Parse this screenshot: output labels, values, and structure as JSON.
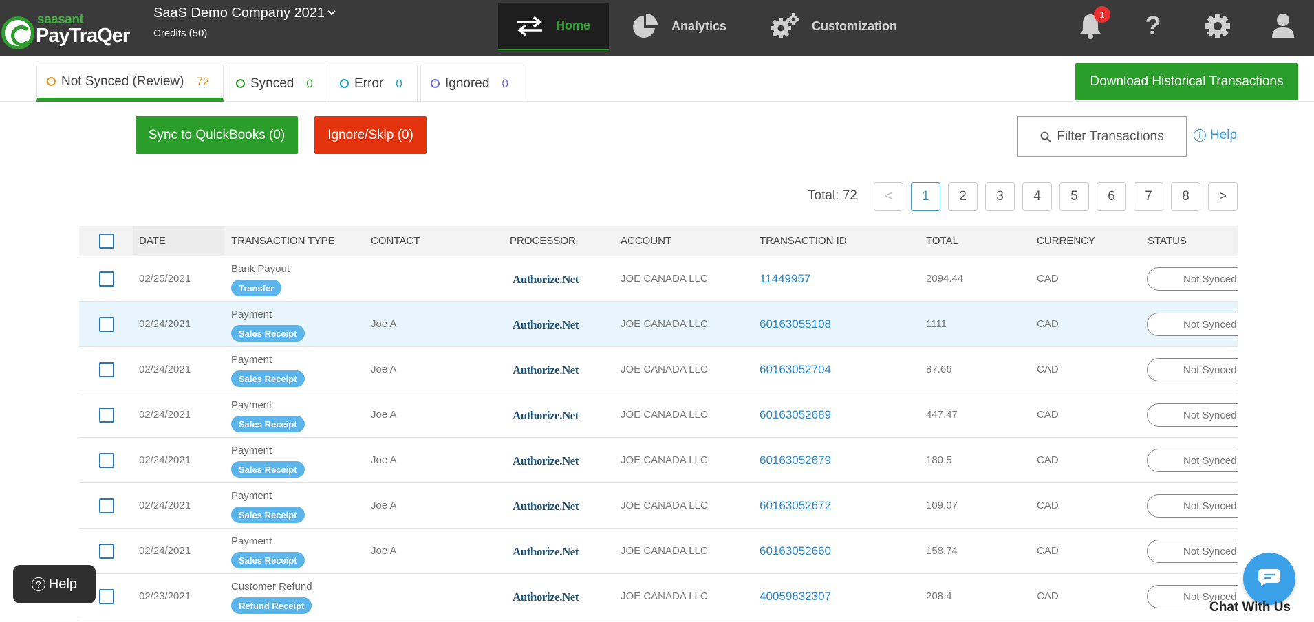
{
  "app": {
    "logo_small": "saasant",
    "logo_main": "PayTraQer",
    "company": "SaaS Demo Company 2021",
    "credits": "Credits (50)"
  },
  "nav": {
    "home": "Home",
    "analytics": "Analytics",
    "customization": "Customization",
    "notification_count": "1",
    "help_symbol": "?"
  },
  "tabs": [
    {
      "label": "Not Synced (Review)",
      "count": "72",
      "color": "#e0961e"
    },
    {
      "label": "Synced",
      "count": "0",
      "color": "#2a9d2a"
    },
    {
      "label": "Error",
      "count": "0",
      "color": "#1aa5b8"
    },
    {
      "label": "Ignored",
      "count": "0",
      "color": "#6b6be0"
    }
  ],
  "actions": {
    "download": "Download Historical Transactions",
    "sync": "Sync to QuickBooks (0)",
    "ignore": "Ignore/Skip (0)",
    "filter": "Filter Transactions",
    "help": "Help"
  },
  "pagination": {
    "total": "Total: 72",
    "prev": "<",
    "next": ">",
    "pages": [
      "1",
      "2",
      "3",
      "4",
      "5",
      "6",
      "7",
      "8"
    ],
    "current": "1"
  },
  "table": {
    "headers": [
      "DATE",
      "TRANSACTION TYPE",
      "CONTACT",
      "PROCESSOR",
      "ACCOUNT",
      "TRANSACTION ID",
      "TOTAL",
      "CURRENCY",
      "STATUS"
    ],
    "rows": [
      {
        "date": "02/25/2021",
        "type": "Bank Payout",
        "tag": "Transfer",
        "contact": "",
        "processor": "Authorize.Net",
        "account": "JOE CANADA LLC",
        "txid": "11449957",
        "total": "2094.44",
        "currency": "CAD",
        "status": "Not Synced"
      },
      {
        "date": "02/24/2021",
        "type": "Payment",
        "tag": "Sales Receipt",
        "contact": "Joe A",
        "processor": "Authorize.Net",
        "account": "JOE CANADA LLC",
        "txid": "60163055108",
        "total": "1111",
        "currency": "CAD",
        "status": "Not Synced"
      },
      {
        "date": "02/24/2021",
        "type": "Payment",
        "tag": "Sales Receipt",
        "contact": "Joe A",
        "processor": "Authorize.Net",
        "account": "JOE CANADA LLC",
        "txid": "60163052704",
        "total": "87.66",
        "currency": "CAD",
        "status": "Not Synced"
      },
      {
        "date": "02/24/2021",
        "type": "Payment",
        "tag": "Sales Receipt",
        "contact": "Joe A",
        "processor": "Authorize.Net",
        "account": "JOE CANADA LLC",
        "txid": "60163052689",
        "total": "447.47",
        "currency": "CAD",
        "status": "Not Synced"
      },
      {
        "date": "02/24/2021",
        "type": "Payment",
        "tag": "Sales Receipt",
        "contact": "Joe A",
        "processor": "Authorize.Net",
        "account": "JOE CANADA LLC",
        "txid": "60163052679",
        "total": "180.5",
        "currency": "CAD",
        "status": "Not Synced"
      },
      {
        "date": "02/24/2021",
        "type": "Payment",
        "tag": "Sales Receipt",
        "contact": "Joe A",
        "processor": "Authorize.Net",
        "account": "JOE CANADA LLC",
        "txid": "60163052672",
        "total": "109.07",
        "currency": "CAD",
        "status": "Not Synced"
      },
      {
        "date": "02/24/2021",
        "type": "Payment",
        "tag": "Sales Receipt",
        "contact": "Joe A",
        "processor": "Authorize.Net",
        "account": "JOE CANADA LLC",
        "txid": "60163052660",
        "total": "158.74",
        "currency": "CAD",
        "status": "Not Synced"
      },
      {
        "date": "02/23/2021",
        "type": "Customer Refund",
        "tag": "Refund Receipt",
        "contact": "",
        "processor": "Authorize.Net",
        "account": "JOE CANADA LLC",
        "txid": "40059632307",
        "total": "208.4",
        "currency": "CAD",
        "status": "Not Synced"
      }
    ]
  },
  "floating": {
    "help": "Help",
    "chat": "Chat With Us"
  },
  "colors": {
    "topbar": "#3a3a3a",
    "brand_green": "#2a9d2a",
    "danger": "#e3330e",
    "link": "#2a86c8",
    "tag": "#5bb4ea"
  }
}
